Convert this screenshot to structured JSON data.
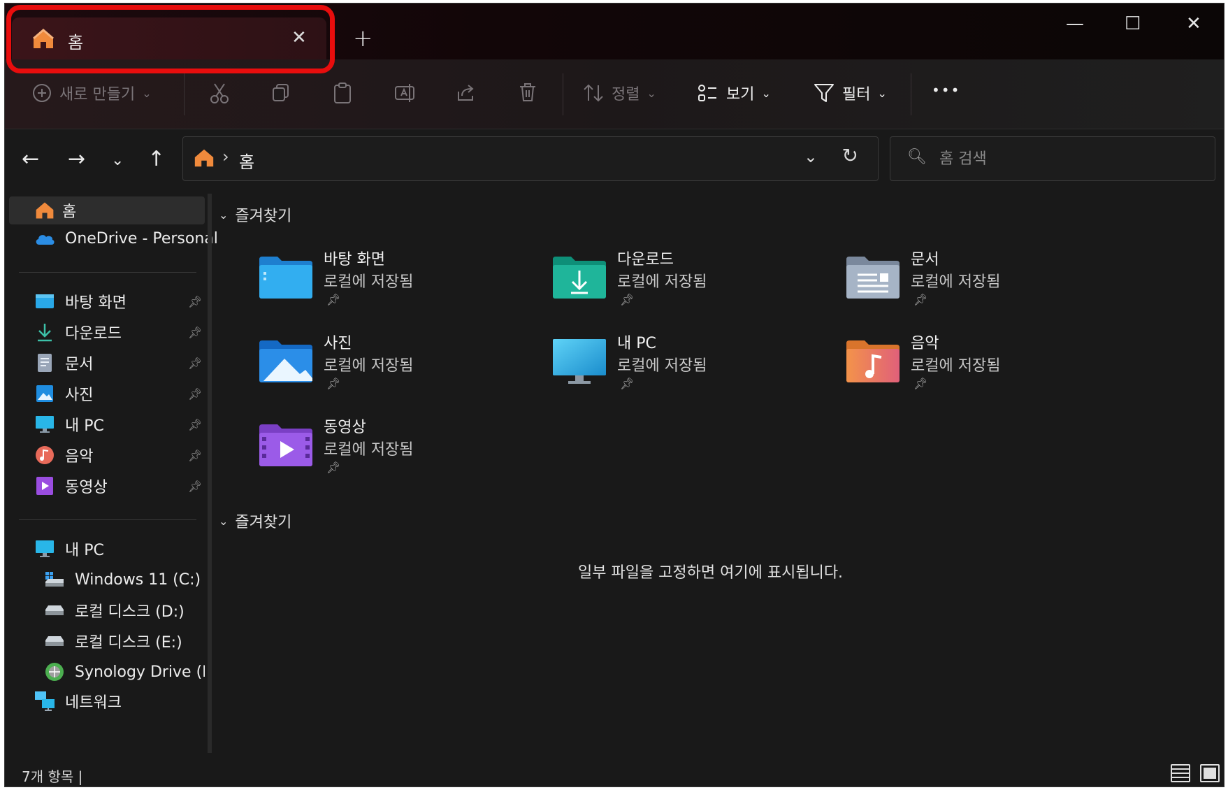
{
  "tab": {
    "title": "홈",
    "close": "✕"
  },
  "window_controls": {
    "minimize": "—",
    "maximize": "☐",
    "close": "✕"
  },
  "new_tab": "+",
  "commands": {
    "new": "새로 만들기",
    "sort": "정렬",
    "view": "보기",
    "filter": "필터",
    "more": "•••"
  },
  "address": {
    "crumb": "홈"
  },
  "search": {
    "placeholder": "홈 검색"
  },
  "sidebar": {
    "home": "홈",
    "onedrive": "OneDrive - Personal",
    "quick": [
      "바탕 화면",
      "다운로드",
      "문서",
      "사진",
      "내 PC",
      "음악",
      "동영상"
    ],
    "thispc": "내 PC",
    "drives": [
      "Windows 11 (C:)",
      "로컬 디스크 (D:)",
      "로컬 디스크 (E:)",
      "Synology Drive (IP"
    ],
    "network": "네트워크"
  },
  "main": {
    "quick_access_header": "즐겨찾기",
    "favorites_header": "즐겨찾기",
    "empty_message": "일부 파일을 고정하면 여기에 표시됩니다.",
    "tiles": [
      {
        "name": "바탕 화면",
        "sub": "로컬에 저장됨"
      },
      {
        "name": "다운로드",
        "sub": "로컬에 저장됨"
      },
      {
        "name": "문서",
        "sub": "로컬에 저장됨"
      },
      {
        "name": "사진",
        "sub": "로컬에 저장됨"
      },
      {
        "name": "내 PC",
        "sub": "로컬에 저장됨"
      },
      {
        "name": "음악",
        "sub": "로컬에 저장됨"
      },
      {
        "name": "동영상",
        "sub": "로컬에 저장됨"
      }
    ]
  },
  "status": {
    "count": "7개 항목  |"
  },
  "colors": {
    "highlight": "#e80d0d",
    "accent_home": "#f08a3c"
  }
}
